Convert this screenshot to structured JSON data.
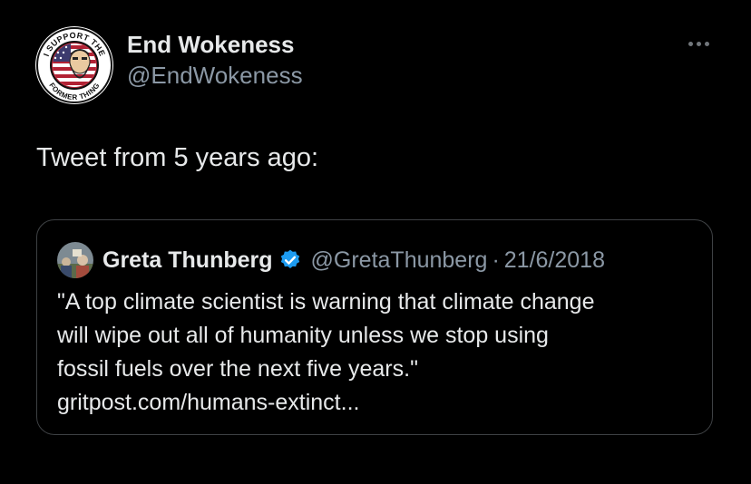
{
  "author": {
    "display_name": "End Wokeness",
    "handle": "@EndWokeness",
    "avatar_icon": "i-support-the-former-thing-badge-icon",
    "avatar_text_top": "I SUPPORT THE",
    "avatar_text_bottom": "FORMER THING"
  },
  "menu": {
    "icon": "more-options-icon"
  },
  "tweet": {
    "text": "Tweet from 5 years ago:"
  },
  "quote": {
    "display_name": "Greta Thunberg",
    "handle": "@GretaThunberg",
    "separator": "·",
    "date": "21/6/2018",
    "verified_icon": "verified-badge-icon",
    "lines": [
      "\"A top climate scientist is warning that climate change",
      "will wipe out all of humanity unless we stop using",
      "fossil fuels over the next five years.\"",
      "gritpost.com/humans-extinct..."
    ]
  },
  "colors": {
    "background": "#000000",
    "primary_text": "#e7e9ea",
    "secondary_text": "#8b98a5",
    "verified_blue": "#1d9bf0",
    "quote_border": "#3e4144"
  }
}
